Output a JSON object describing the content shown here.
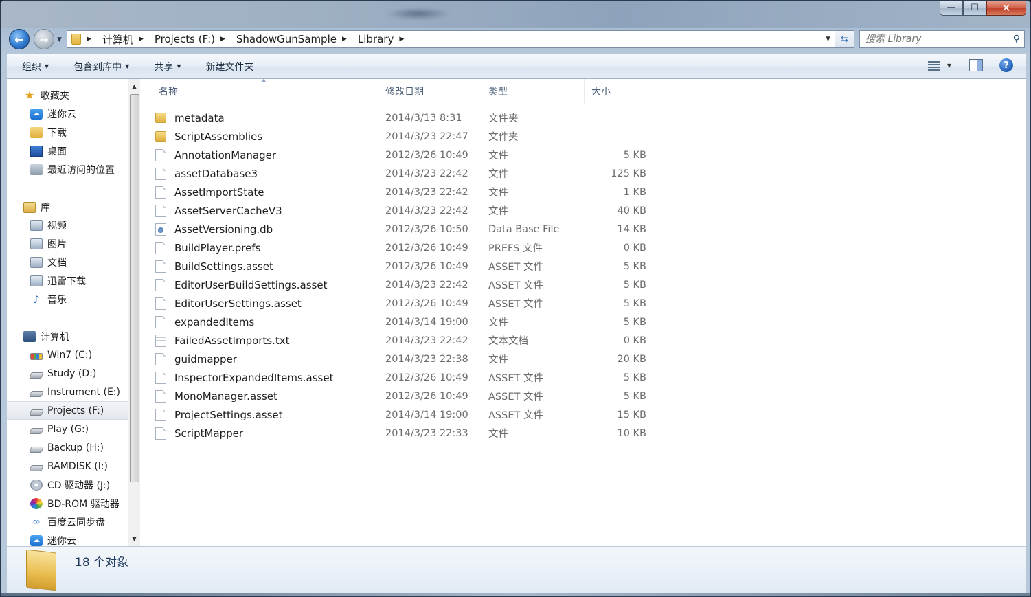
{
  "window": {
    "minimize_glyph": "—",
    "maximize_glyph": "☐",
    "close_glyph": "✕"
  },
  "address_bar": {
    "breadcrumbs": [
      "计算机",
      "Projects (F:)",
      "ShadowGunSample",
      "Library"
    ],
    "search_placeholder": "搜索 Library"
  },
  "toolbar": {
    "organize": "组织",
    "include_in_library": "包含到库中",
    "share": "共享",
    "new_folder": "新建文件夹"
  },
  "nav_pane": {
    "favorites": {
      "label": "收藏夹",
      "items": [
        "迷你云",
        "下载",
        "桌面",
        "最近访问的位置"
      ]
    },
    "libraries": {
      "label": "库",
      "items": [
        "视频",
        "图片",
        "文档",
        "迅雷下载",
        "音乐"
      ]
    },
    "computer": {
      "label": "计算机",
      "items": [
        "Win7 (C:)",
        "Study (D:)",
        "Instrument (E:)",
        "Projects (F:)",
        "Play (G:)",
        "Backup (H:)",
        "RAMDISK (I:)",
        "CD 驱动器 (J:)",
        "BD-ROM 驱动器",
        "百度云同步盘",
        "迷你云"
      ]
    }
  },
  "file_list": {
    "columns": {
      "name": "名称",
      "date": "修改日期",
      "type": "类型",
      "size": "大小"
    },
    "rows": [
      {
        "name": "metadata",
        "date": "2014/3/13 8:31",
        "type": "文件夹",
        "size": "",
        "icon": "folder"
      },
      {
        "name": "ScriptAssemblies",
        "date": "2014/3/23 22:47",
        "type": "文件夹",
        "size": "",
        "icon": "folder"
      },
      {
        "name": "AnnotationManager",
        "date": "2012/3/26 10:49",
        "type": "文件",
        "size": "5 KB",
        "icon": "file"
      },
      {
        "name": "assetDatabase3",
        "date": "2014/3/23 22:42",
        "type": "文件",
        "size": "125 KB",
        "icon": "file"
      },
      {
        "name": "AssetImportState",
        "date": "2014/3/23 22:42",
        "type": "文件",
        "size": "1 KB",
        "icon": "file"
      },
      {
        "name": "AssetServerCacheV3",
        "date": "2014/3/23 22:42",
        "type": "文件",
        "size": "40 KB",
        "icon": "file"
      },
      {
        "name": "AssetVersioning.db",
        "date": "2012/3/26 10:50",
        "type": "Data Base File",
        "size": "14 KB",
        "icon": "db"
      },
      {
        "name": "BuildPlayer.prefs",
        "date": "2012/3/26 10:49",
        "type": "PREFS 文件",
        "size": "0 KB",
        "icon": "file"
      },
      {
        "name": "BuildSettings.asset",
        "date": "2012/3/26 10:49",
        "type": "ASSET 文件",
        "size": "5 KB",
        "icon": "file"
      },
      {
        "name": "EditorUserBuildSettings.asset",
        "date": "2014/3/23 22:42",
        "type": "ASSET 文件",
        "size": "5 KB",
        "icon": "file"
      },
      {
        "name": "EditorUserSettings.asset",
        "date": "2012/3/26 10:49",
        "type": "ASSET 文件",
        "size": "5 KB",
        "icon": "file"
      },
      {
        "name": "expandedItems",
        "date": "2014/3/14 19:00",
        "type": "文件",
        "size": "5 KB",
        "icon": "file"
      },
      {
        "name": "FailedAssetImports.txt",
        "date": "2014/3/23 22:42",
        "type": "文本文档",
        "size": "0 KB",
        "icon": "txt"
      },
      {
        "name": "guidmapper",
        "date": "2014/3/23 22:38",
        "type": "文件",
        "size": "20 KB",
        "icon": "file"
      },
      {
        "name": "InspectorExpandedItems.asset",
        "date": "2012/3/26 10:49",
        "type": "ASSET 文件",
        "size": "5 KB",
        "icon": "file"
      },
      {
        "name": "MonoManager.asset",
        "date": "2012/3/26 10:49",
        "type": "ASSET 文件",
        "size": "5 KB",
        "icon": "file"
      },
      {
        "name": "ProjectSettings.asset",
        "date": "2014/3/14 19:00",
        "type": "ASSET 文件",
        "size": "15 KB",
        "icon": "file"
      },
      {
        "name": "ScriptMapper",
        "date": "2014/3/23 22:33",
        "type": "文件",
        "size": "10 KB",
        "icon": "file"
      }
    ]
  },
  "details_pane": {
    "item_count": "18 个对象"
  }
}
